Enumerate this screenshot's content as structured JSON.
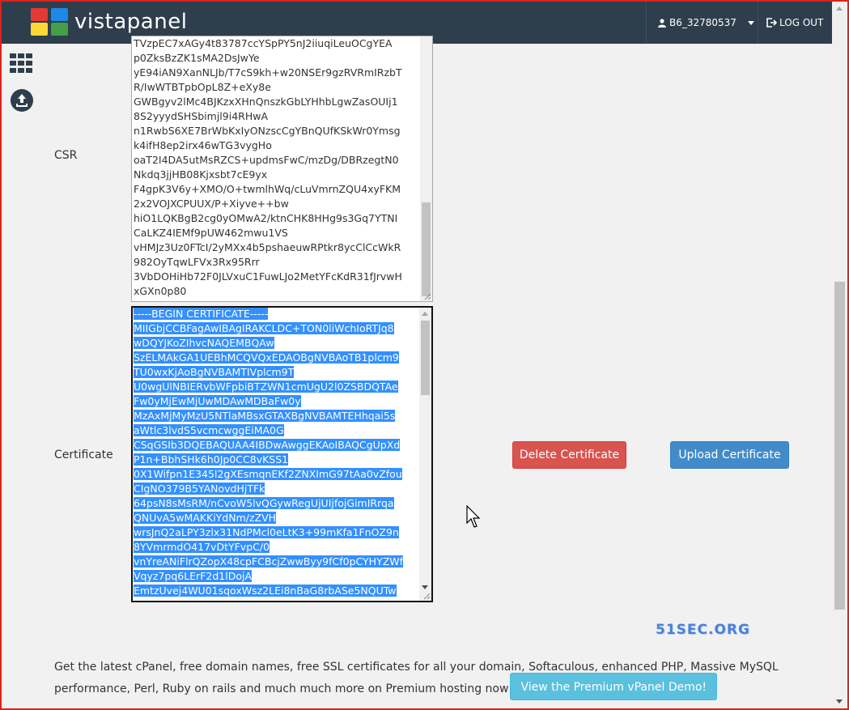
{
  "header": {
    "logo_text": "vistapanel",
    "username": "B6_32780537",
    "logout_label": "LOG OUT"
  },
  "sidebar": {
    "icons": [
      "grid-icon",
      "upload-icon"
    ]
  },
  "form": {
    "csr_label": "CSR",
    "csr_lines": [
      "TVzpEC7xAGy4t83787ccYSpPY5nJ2iiuqiLeuOCgYEA",
      "p0ZksBzZK1sMA2DsJwYe",
      "yE94iAN9XanNLJb/T7cS9kh+w20NSEr9gzRVRmIRzbT",
      "R/IwWTBTpbOpL8Z+eXy8e",
      "GWBgyv2lMc4BJKzxXHnQnszkGbLYHhbLgwZasOUIj1",
      "8S2yyydSHSbimjl9i4RHwA",
      "n1RwbS6XE7BrWbKxIyONzscCgYBnQUfKSkWr0Ymsg",
      "k4ifH8ep2irx46wTG3vygHo",
      "oaT2I4DA5utMsRZCS+updmsFwC/mzDg/DBRzegtN0",
      "Nkdq3jjHB08Kjxsbt7cE9yx",
      "F4gpK3V6y+XMO/O+twmlhWq/cLuVmrnZQU4xyFKM",
      "2x2VOJXCPUUX/P+Xiyve++bw",
      "hiO1LQKBgB2cg0yOMwA2/ktnCHK8HHg9s3Gq7YTNI",
      "CaLKZ4IEMf9pUW462mwu1VS",
      "vHMJz3Uz0FTcI/2yMXx4b5pshaeuwRPtkr8ycClCcWkR",
      "982OyTqwLFVx3Rx95Rrr",
      "3VbDOHiHb72F0JLVxuC1FuwLJo2MetYFcKdR31fJrvwH",
      "xGXn0p80"
    ],
    "certificate_label": "Certificate",
    "certificate_lines": [
      "-----BEGIN CERTIFICATE-----",
      "MIIGbjCCBFagAwIBAgIRAKCLDC+TON0liWchIoRTJq8",
      "wDQYJKoZIhvcNAQEMBQAw",
      "SzELMAkGA1UEBhMCQVQxEDAOBgNVBAoTB1plcm9",
      "TU0wxKjAoBgNVBAMTIVplcm9T",
      "U0wgUlNBIERvbWFpbiBTZWN1cmUgU2l0ZSBDQTAe",
      "Fw0yMjEwMjUwMDAwMDBaFw0y",
      "MzAxMjMyMzU5NTlaMBsxGTAXBgNVBAMTEHhqai5s",
      "aWtlc3lvdS5vcmcwggEiMA0G",
      "CSqGSIb3DQEBAQUAA4IBDwAwggEKAoIBAQCgUpXd",
      "P1n+BbhSHk6h0Jp0CC8vKSS1",
      "0X1Wifpn1E345l2gXEsmqnEKf2ZNXImG97tAa0vZfou",
      "CIgNO379B5YANovdHjTFk",
      "64psN8sMsRM/nCvoW5lvQGywRegUjUIjfojGimIRrqa",
      "QNUvA5wMAKKiYdNm/zZVH",
      "wrsJnQ2aLPY3zlx31NdPMcl0eLtK3+99mKfa1FnOZ9n",
      "8YVmrmdO417vDtYFvpC/0",
      "vnYreANiFlrQZopX48cpFCBcjZwwByy9fCf0pCYHYZWf",
      "Vqyz7pq6LErF2d1lDojA",
      "EmtzUvej4WU01sqoxWsz2LEi8nBaG8rbASe5NQUTw"
    ],
    "delete_button": "Delete Certificate",
    "upload_button": "Upload Certificate"
  },
  "watermark": "51SEC.ORG",
  "promo": {
    "text": "Get the latest cPanel, free domain names, free SSL certificates for all your domain, Softaculous, enhanced PHP, Massive MySQL performance, Perl, Ruby on rails and much much more on Premium hosting now! ",
    "button": "View the Premium vPanel Demo!"
  },
  "colors": {
    "topbar": "#2f3e4c",
    "delete": "#d9534f",
    "upload": "#428bca",
    "promo_button": "#5bc0de",
    "selection": "#3390ff",
    "logo_red": "#e53935",
    "logo_blue": "#1e88e5",
    "logo_yellow": "#fdd835",
    "logo_green": "#43a047"
  }
}
